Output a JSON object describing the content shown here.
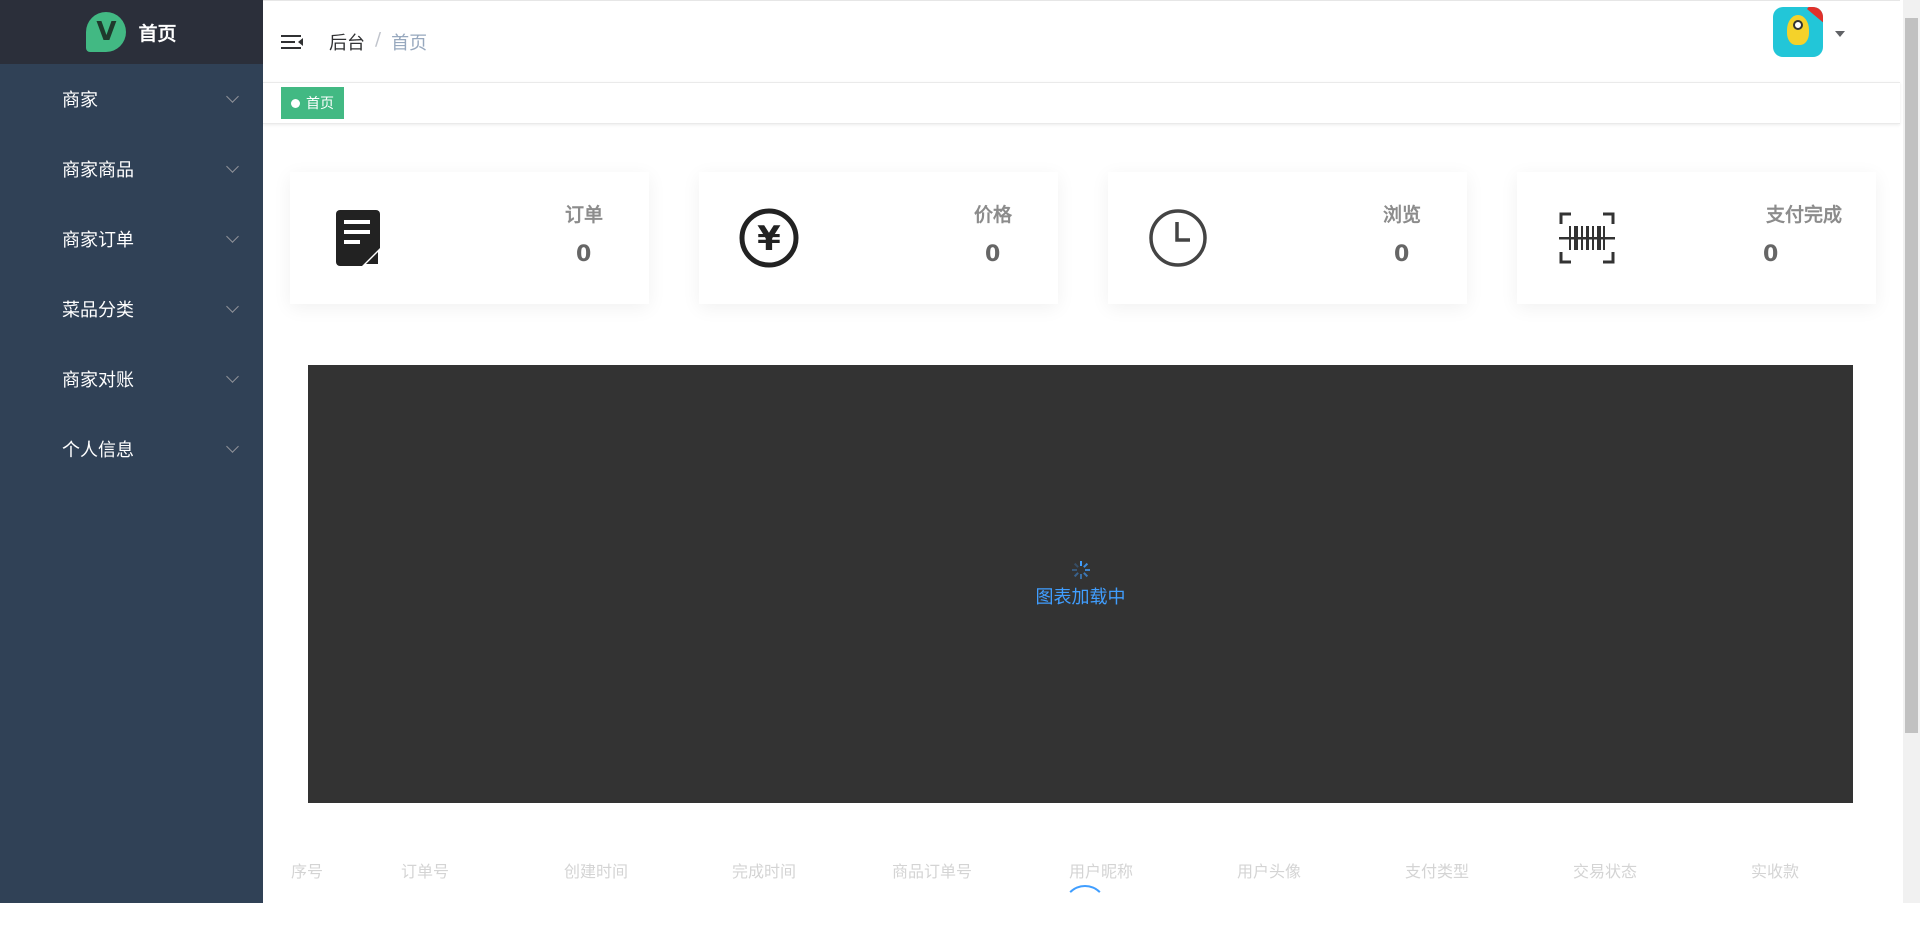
{
  "sidebar": {
    "logo_letter": "V",
    "title": "首页",
    "items": [
      {
        "label": "商家"
      },
      {
        "label": "商家商品"
      },
      {
        "label": "商家订单"
      },
      {
        "label": "菜品分类"
      },
      {
        "label": "商家对账"
      },
      {
        "label": "个人信息"
      }
    ]
  },
  "navbar": {
    "breadcrumb": [
      "后台",
      "首页"
    ],
    "separator": "/"
  },
  "tags": [
    {
      "label": "首页"
    }
  ],
  "stats": [
    {
      "label": "订单",
      "value": "0",
      "icon": "document-icon"
    },
    {
      "label": "价格",
      "value": "0",
      "icon": "yen-icon"
    },
    {
      "label": "浏览",
      "value": "0",
      "icon": "clock-icon"
    },
    {
      "label": "支付完成",
      "value": "0",
      "icon": "barcode-scan-icon"
    }
  ],
  "chart": {
    "loading_text": "图表加载中"
  },
  "table": {
    "columns": [
      "序号",
      "订单号",
      "创建时间",
      "完成时间",
      "商品订单号",
      "用户昵称",
      "用户头像",
      "支付类型",
      "交易状态",
      "实收款"
    ]
  },
  "colors": {
    "sidebar_bg": "#304156",
    "logo_bg": "#2b2f3a",
    "accent": "#42b983",
    "chart_bg": "#333333",
    "loading": "#409eff"
  }
}
